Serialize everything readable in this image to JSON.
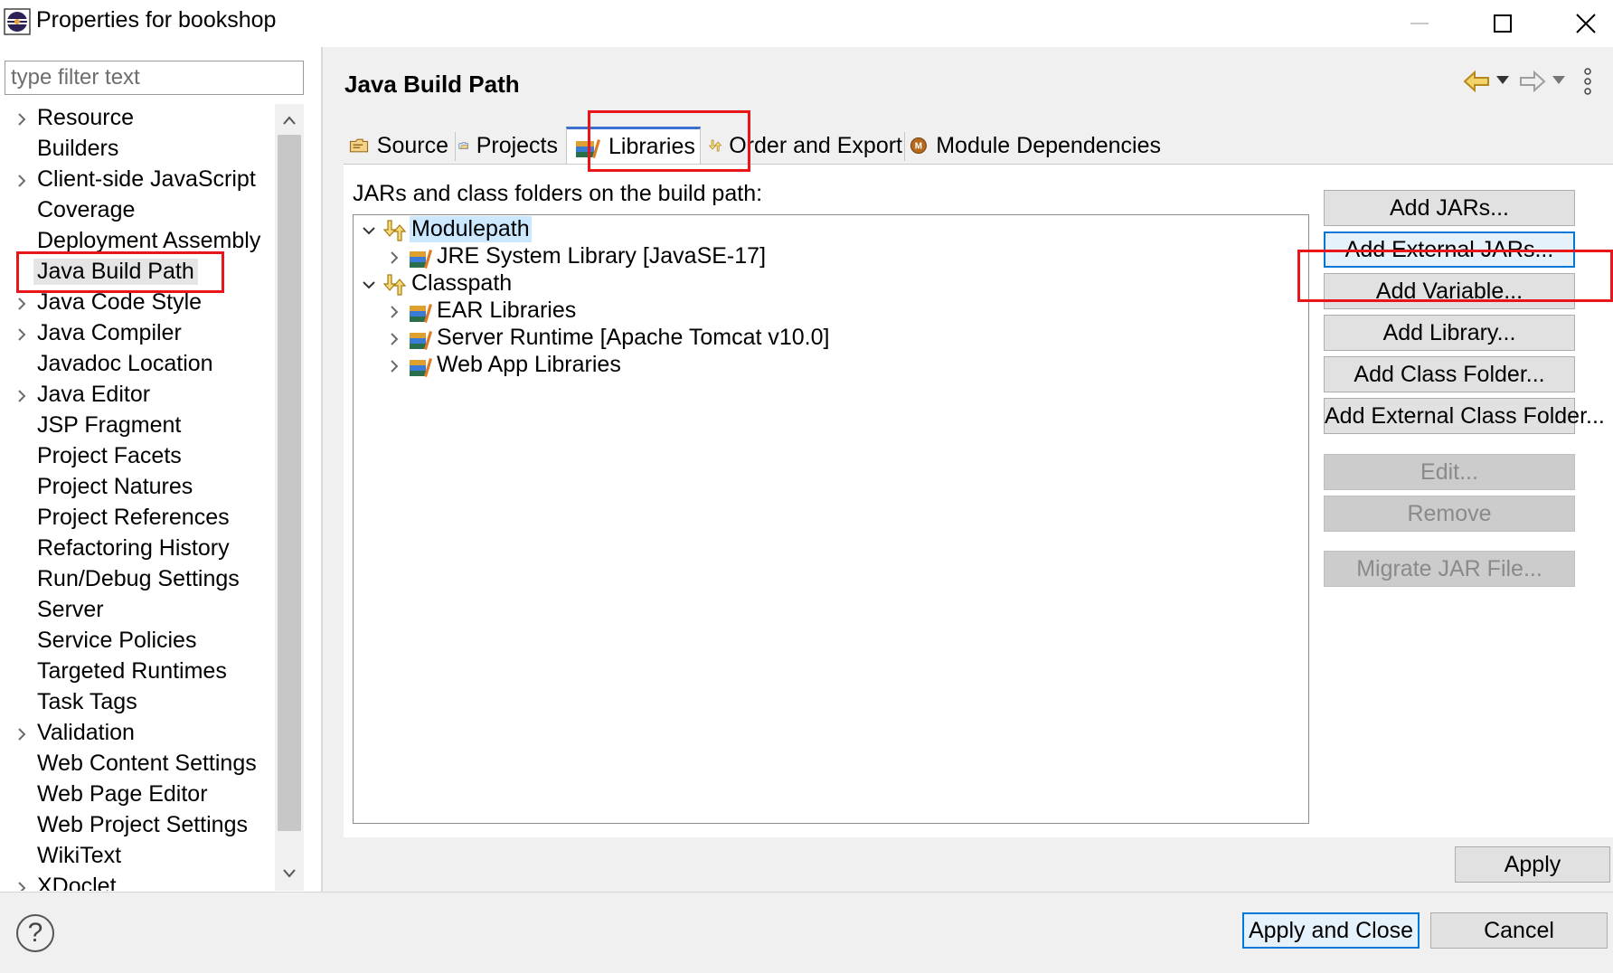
{
  "window": {
    "title": "Properties for bookshop",
    "minimize_glyph": "—",
    "maximize_glyph": "☐",
    "close_glyph": "✕"
  },
  "filter": {
    "placeholder": "type filter text",
    "value": ""
  },
  "nav_tree": {
    "items": [
      {
        "label": "Resource",
        "expandable": true
      },
      {
        "label": "Builders",
        "expandable": false
      },
      {
        "label": "Client-side JavaScript",
        "expandable": true
      },
      {
        "label": "Coverage",
        "expandable": false
      },
      {
        "label": "Deployment Assembly",
        "expandable": false
      },
      {
        "label": "Java Build Path",
        "expandable": false,
        "selected": true
      },
      {
        "label": "Java Code Style",
        "expandable": true
      },
      {
        "label": "Java Compiler",
        "expandable": true
      },
      {
        "label": "Javadoc Location",
        "expandable": false
      },
      {
        "label": "Java Editor",
        "expandable": true
      },
      {
        "label": "JSP Fragment",
        "expandable": false
      },
      {
        "label": "Project Facets",
        "expandable": false
      },
      {
        "label": "Project Natures",
        "expandable": false
      },
      {
        "label": "Project References",
        "expandable": false
      },
      {
        "label": "Refactoring History",
        "expandable": false
      },
      {
        "label": "Run/Debug Settings",
        "expandable": false
      },
      {
        "label": "Server",
        "expandable": false
      },
      {
        "label": "Service Policies",
        "expandable": false
      },
      {
        "label": "Targeted Runtimes",
        "expandable": false
      },
      {
        "label": "Task Tags",
        "expandable": false
      },
      {
        "label": "Validation",
        "expandable": true
      },
      {
        "label": "Web Content Settings",
        "expandable": false
      },
      {
        "label": "Web Page Editor",
        "expandable": false
      },
      {
        "label": "Web Project Settings",
        "expandable": false
      },
      {
        "label": "WikiText",
        "expandable": false
      },
      {
        "label": "XDoclet",
        "expandable": true
      }
    ]
  },
  "page": {
    "title": "Java Build Path"
  },
  "tabs": [
    {
      "label": "Source",
      "icon": "source-folder-icon"
    },
    {
      "label": "Projects",
      "icon": "projects-folder-icon"
    },
    {
      "label": "Libraries",
      "icon": "libraries-icon",
      "active": true
    },
    {
      "label": "Order and Export",
      "icon": "order-export-icon"
    },
    {
      "label": "Module Dependencies",
      "icon": "module-icon"
    }
  ],
  "libraries": {
    "section_label": "JARs and class folders on the build path:",
    "tree": [
      {
        "label": "Modulepath",
        "level": 0,
        "expanded": true,
        "icon": "path-icon",
        "highlighted": true
      },
      {
        "label": "JRE System Library [JavaSE-17]",
        "level": 1,
        "expanded": false,
        "icon": "library-icon"
      },
      {
        "label": "Classpath",
        "level": 0,
        "expanded": true,
        "icon": "path-icon"
      },
      {
        "label": "EAR Libraries",
        "level": 1,
        "expanded": false,
        "icon": "library-icon"
      },
      {
        "label": "Server Runtime [Apache Tomcat v10.0]",
        "level": 1,
        "expanded": false,
        "icon": "library-icon"
      },
      {
        "label": "Web App Libraries",
        "level": 1,
        "expanded": false,
        "icon": "library-icon"
      }
    ]
  },
  "buttons": {
    "add_jars": "Add JARs...",
    "add_external_jars": "Add External JARs...",
    "add_variable": "Add Variable...",
    "add_library": "Add Library...",
    "add_class_folder": "Add Class Folder...",
    "add_external_class_folder": "Add External Class Folder...",
    "edit": "Edit...",
    "remove": "Remove",
    "migrate_jar": "Migrate JAR File...",
    "apply": "Apply",
    "apply_and_close": "Apply and Close",
    "cancel": "Cancel",
    "help": "?"
  },
  "colors": {
    "highlight_box": "#e8161b",
    "selection": "#cce8ff",
    "focus_border": "#0078d7"
  }
}
